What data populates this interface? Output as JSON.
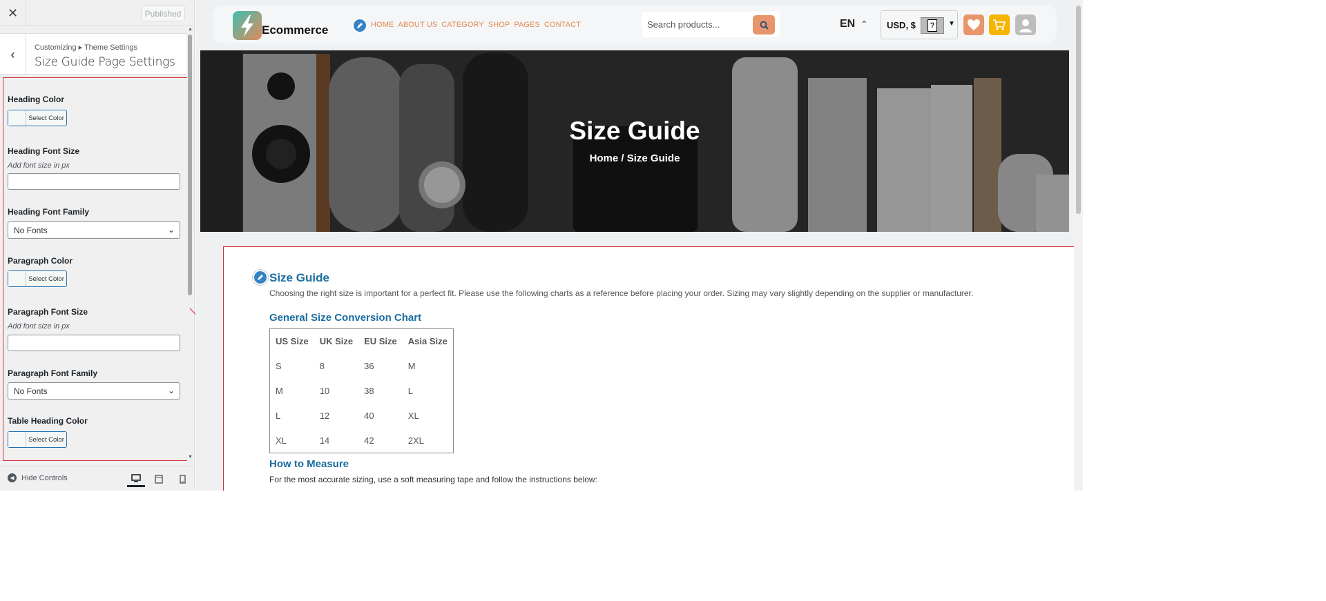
{
  "sidebar": {
    "close_icon": "close-icon",
    "published_label": "Published",
    "breadcrumb": "Customizing ▸ Theme Settings",
    "section_title": "Size Guide Page Settings",
    "controls": {
      "heading_color_label": "Heading Color",
      "heading_color_button": "Select Color",
      "heading_font_size_label": "Heading Font Size",
      "heading_font_size_desc": "Add font size in px",
      "heading_font_size_value": "",
      "heading_font_family_label": "Heading Font Family",
      "heading_font_family_value": "No Fonts",
      "paragraph_color_label": "Paragraph Color",
      "paragraph_color_button": "Select Color",
      "paragraph_font_size_label": "Paragraph Font Size",
      "paragraph_font_size_desc": "Add font size in px",
      "paragraph_font_size_value": "",
      "paragraph_font_family_label": "Paragraph Font Family",
      "paragraph_font_family_value": "No Fonts",
      "table_heading_color_label": "Table Heading Color",
      "table_heading_color_button": "Select Color"
    },
    "footer": {
      "hide_controls_label": "Hide Controls",
      "devices": [
        "desktop",
        "tablet",
        "mobile"
      ],
      "active_device": "desktop"
    }
  },
  "preview": {
    "logo_text": "Ecommerce",
    "nav_links": [
      "HOME",
      "ABOUT US",
      "CATEGORY",
      "SHOP",
      "PAGES",
      "CONTACT"
    ],
    "search_placeholder": "Search products...",
    "language": "EN",
    "currency": "USD, $",
    "hero": {
      "title": "Size Guide",
      "breadcrumb": "Home / Size Guide"
    },
    "content": {
      "title": "Size Guide",
      "intro": "Choosing the right size is important for a perfect fit. Please use the following charts as a reference before placing your order. Sizing may vary slightly depending on the supplier or manufacturer.",
      "chart_title": "General Size Conversion Chart",
      "table": {
        "headers": [
          "US Size",
          "UK Size",
          "EU Size",
          "Asia Size"
        ],
        "rows": [
          [
            "S",
            "8",
            "36",
            "M"
          ],
          [
            "M",
            "10",
            "38",
            "L"
          ],
          [
            "L",
            "12",
            "40",
            "XL"
          ],
          [
            "XL",
            "14",
            "42",
            "2XL"
          ]
        ]
      },
      "measure_title": "How to Measure",
      "measure_text": "For the most accurate sizing, use a soft measuring tape and follow the instructions below:"
    }
  },
  "colors": {
    "accent_orange": "#e68a55",
    "heading_blue": "#1a6ea0",
    "highlight_red": "#d32f2f",
    "wp_blue": "#2271b1"
  }
}
